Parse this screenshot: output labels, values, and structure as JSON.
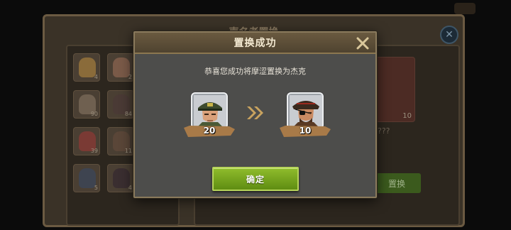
{
  "background": {
    "title": "声名者置换",
    "qqq": "???",
    "red_card_count": "10",
    "green_button_label": "置换",
    "close_icon": "close-icon",
    "grid_counts": [
      "4",
      "2",
      "90",
      "84",
      "39",
      "11",
      "5",
      "4"
    ]
  },
  "modal": {
    "title": "置换成功",
    "close_icon": "close-x-icon",
    "message": "恭喜您成功将摩涩置换为杰克",
    "from_hero": {
      "count": "20",
      "icon": "soldier-portrait"
    },
    "to_hero": {
      "count": "10",
      "icon": "pirate-portrait"
    },
    "arrow_icon": "double-chevron-right-icon",
    "confirm_label": "确定"
  },
  "colors": {
    "confirm_green": "#7aa51f",
    "header_brown": "#5d4f38",
    "gold_close": "#d9c79b"
  }
}
